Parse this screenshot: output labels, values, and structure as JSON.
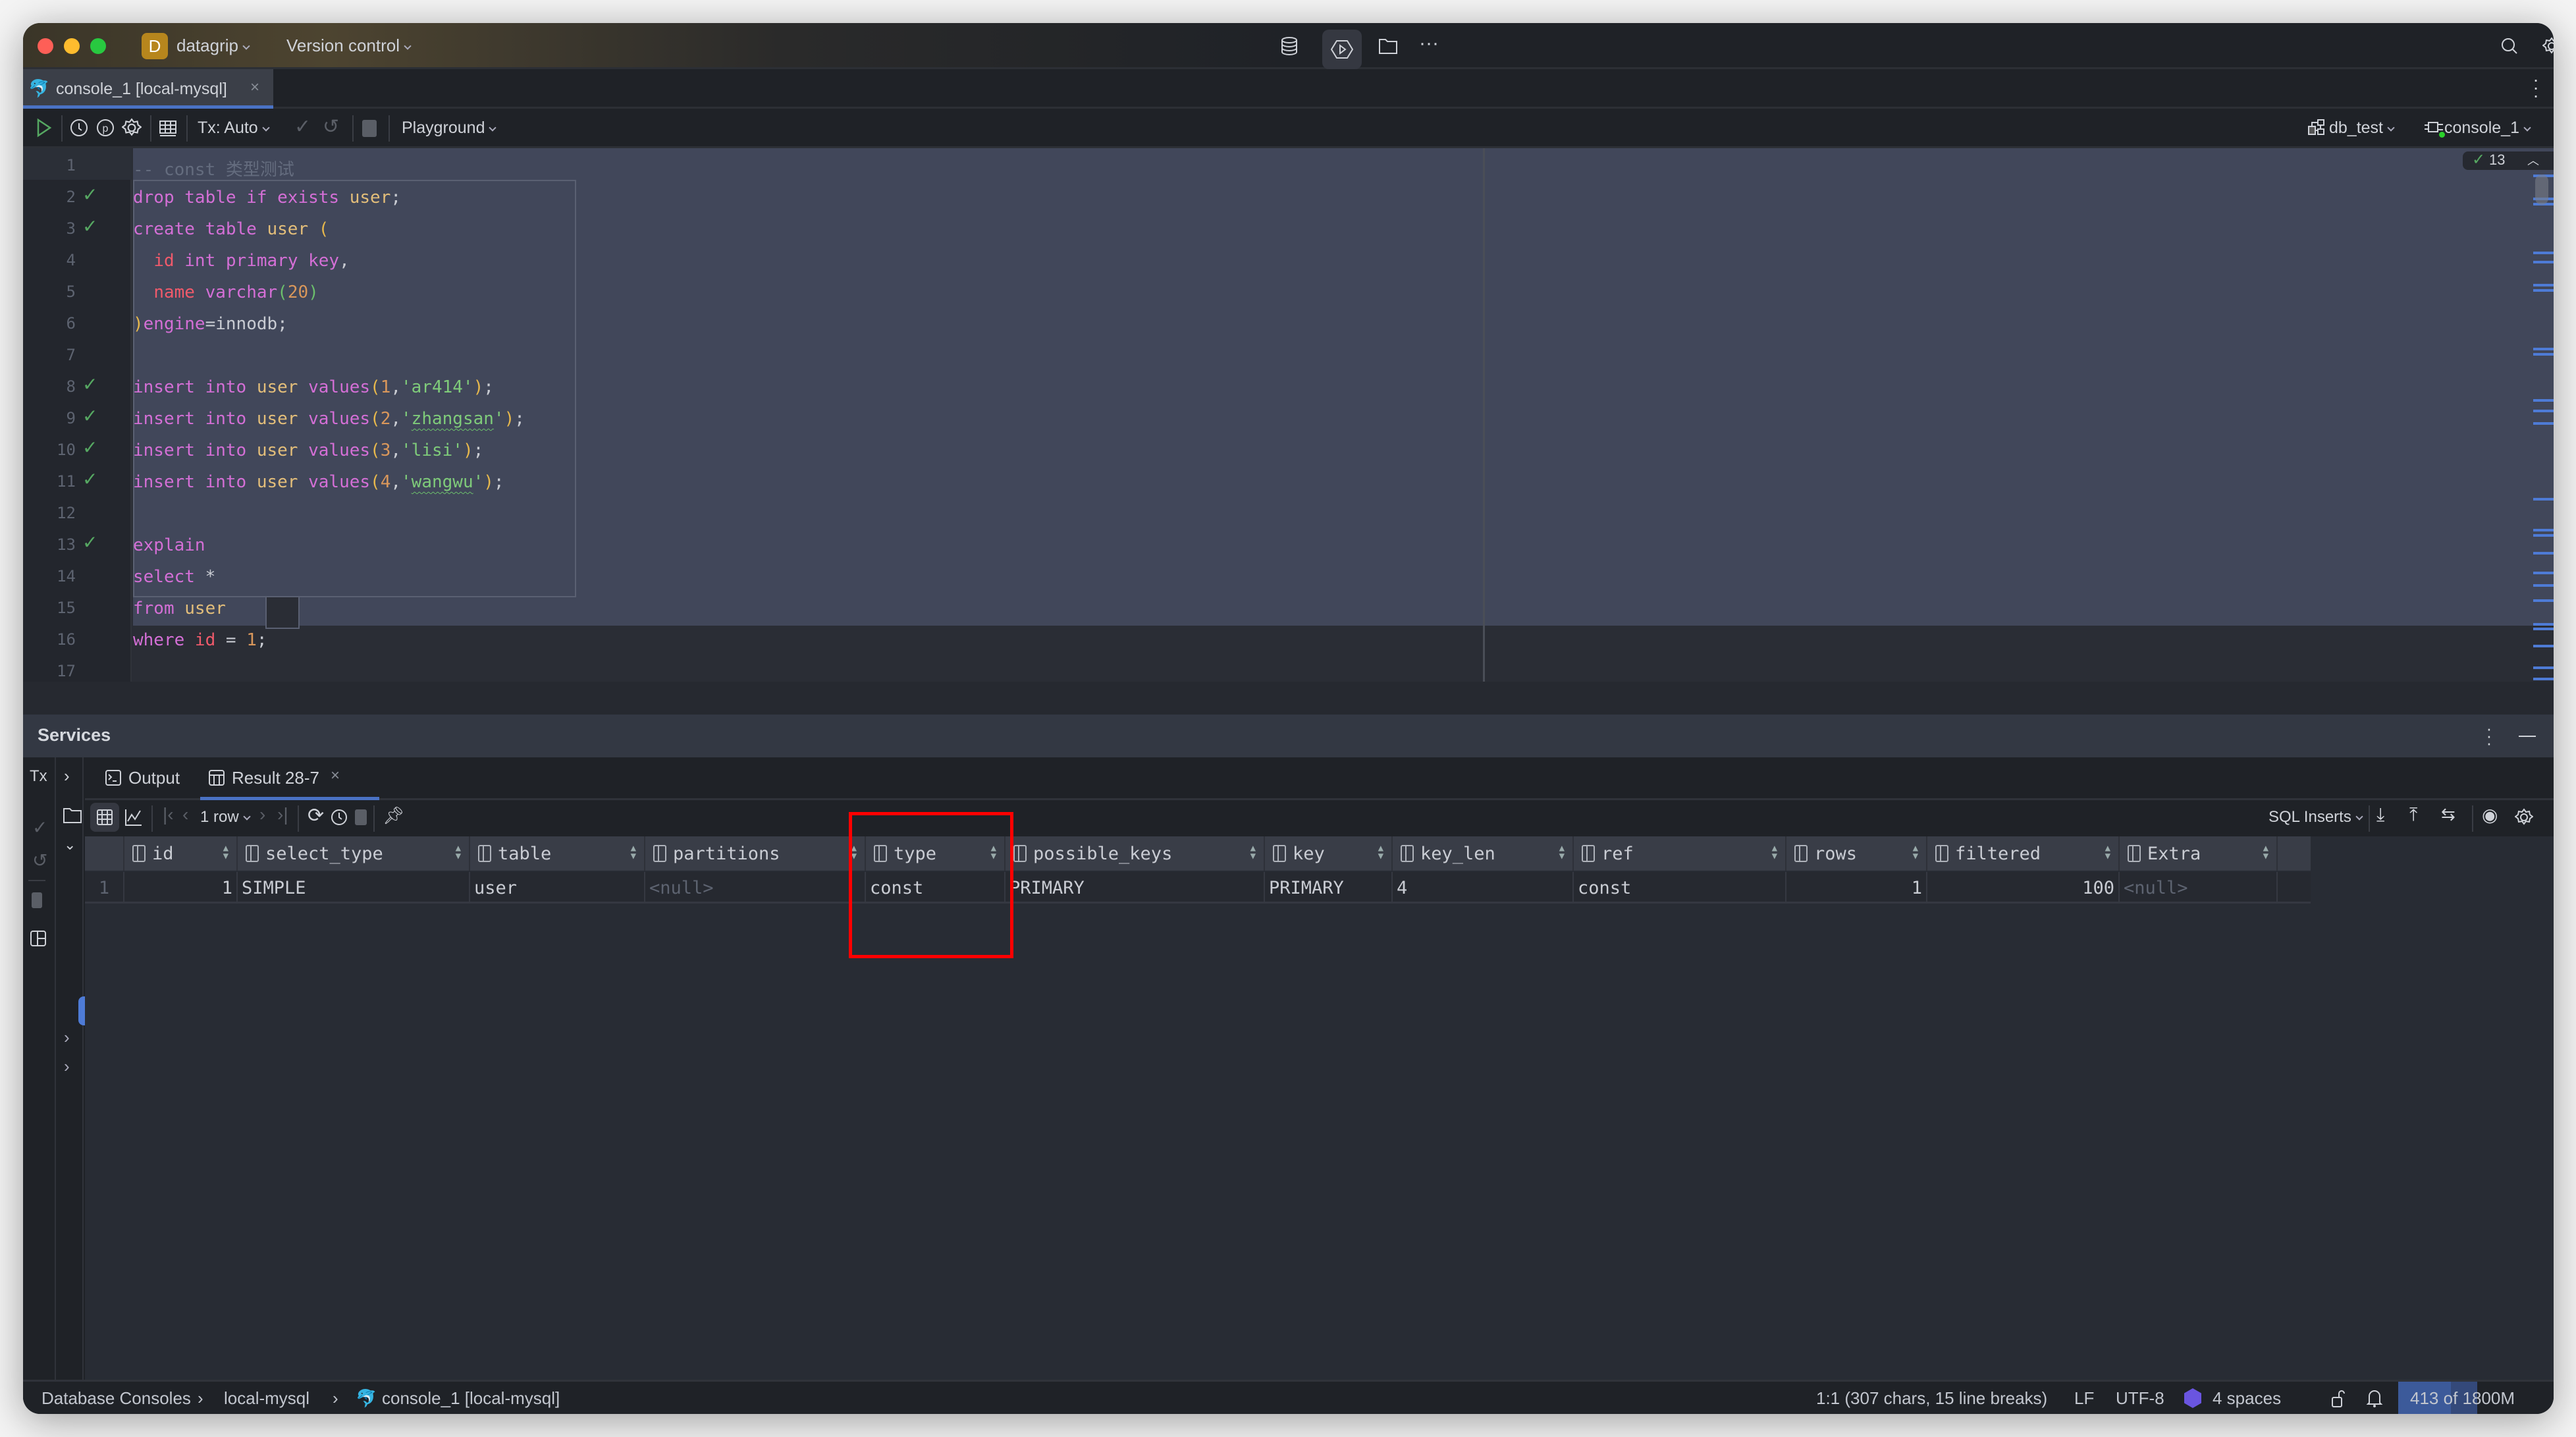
{
  "window": {
    "project_badge": "D",
    "project_name": "datagrip",
    "vcs_label": "Version control"
  },
  "editor_tab": {
    "label": "console_1 [local-mysql]",
    "close": "×"
  },
  "toolbar": {
    "tx_label": "Tx: Auto",
    "playground_label": "Playground",
    "schema_label": "db_test",
    "session_label": "console_1"
  },
  "inspection": {
    "count": "13"
  },
  "editor": {
    "lines": [
      {
        "n": "1",
        "check": false
      },
      {
        "n": "2",
        "check": true
      },
      {
        "n": "3",
        "check": true
      },
      {
        "n": "4",
        "check": false
      },
      {
        "n": "5",
        "check": false
      },
      {
        "n": "6",
        "check": false
      },
      {
        "n": "7",
        "check": false
      },
      {
        "n": "8",
        "check": true
      },
      {
        "n": "9",
        "check": true
      },
      {
        "n": "10",
        "check": true
      },
      {
        "n": "11",
        "check": true
      },
      {
        "n": "12",
        "check": false
      },
      {
        "n": "13",
        "check": true
      },
      {
        "n": "14",
        "check": false
      },
      {
        "n": "15",
        "check": false
      },
      {
        "n": "16",
        "check": false
      },
      {
        "n": "17",
        "check": false
      }
    ],
    "code": [
      [
        {
          "t": "-- const 类型测试",
          "c": "cmt"
        }
      ],
      [
        {
          "t": "drop table if exists ",
          "c": "kw"
        },
        {
          "t": "user",
          "c": "tb"
        },
        {
          "t": ";",
          "c": ""
        }
      ],
      [
        {
          "t": "create table ",
          "c": "kw"
        },
        {
          "t": "user ",
          "c": "tb"
        },
        {
          "t": "(",
          "c": "par"
        }
      ],
      [
        {
          "t": "  ",
          "c": ""
        },
        {
          "t": "id ",
          "c": "fld"
        },
        {
          "t": "int primary key",
          "c": "kw"
        },
        {
          "t": ",",
          "c": ""
        }
      ],
      [
        {
          "t": "  ",
          "c": ""
        },
        {
          "t": "name ",
          "c": "fld"
        },
        {
          "t": "varchar",
          "c": "kw"
        },
        {
          "t": "(",
          "c": "grn"
        },
        {
          "t": "20",
          "c": "num"
        },
        {
          "t": ")",
          "c": "grn"
        }
      ],
      [
        {
          "t": ")",
          "c": "par"
        },
        {
          "t": "engine",
          "c": "kw"
        },
        {
          "t": "=innodb;",
          "c": ""
        }
      ],
      [],
      [
        {
          "t": "insert into ",
          "c": "kw"
        },
        {
          "t": "user ",
          "c": "tb"
        },
        {
          "t": "values",
          "c": "kw"
        },
        {
          "t": "(",
          "c": "par"
        },
        {
          "t": "1",
          "c": "num"
        },
        {
          "t": ",",
          "c": ""
        },
        {
          "t": "'ar414'",
          "c": "str"
        },
        {
          "t": ")",
          "c": "par"
        },
        {
          "t": ";",
          "c": ""
        }
      ],
      [
        {
          "t": "insert into ",
          "c": "kw"
        },
        {
          "t": "user ",
          "c": "tb"
        },
        {
          "t": "values",
          "c": "kw"
        },
        {
          "t": "(",
          "c": "par"
        },
        {
          "t": "2",
          "c": "num"
        },
        {
          "t": ",",
          "c": ""
        },
        {
          "t": "'",
          "c": "str"
        },
        {
          "t": "zhangsan",
          "c": "str wavy"
        },
        {
          "t": "'",
          "c": "str"
        },
        {
          "t": ")",
          "c": "par"
        },
        {
          "t": ";",
          "c": ""
        }
      ],
      [
        {
          "t": "insert into ",
          "c": "kw"
        },
        {
          "t": "user ",
          "c": "tb"
        },
        {
          "t": "values",
          "c": "kw"
        },
        {
          "t": "(",
          "c": "par"
        },
        {
          "t": "3",
          "c": "num"
        },
        {
          "t": ",",
          "c": ""
        },
        {
          "t": "'lisi'",
          "c": "str"
        },
        {
          "t": ")",
          "c": "par"
        },
        {
          "t": ";",
          "c": ""
        }
      ],
      [
        {
          "t": "insert into ",
          "c": "kw"
        },
        {
          "t": "user ",
          "c": "tb"
        },
        {
          "t": "values",
          "c": "kw"
        },
        {
          "t": "(",
          "c": "par"
        },
        {
          "t": "4",
          "c": "num"
        },
        {
          "t": ",",
          "c": ""
        },
        {
          "t": "'",
          "c": "str"
        },
        {
          "t": "wangwu",
          "c": "str wavy"
        },
        {
          "t": "'",
          "c": "str"
        },
        {
          "t": ")",
          "c": "par"
        },
        {
          "t": ";",
          "c": ""
        }
      ],
      [],
      [
        {
          "t": "explain",
          "c": "kw"
        }
      ],
      [
        {
          "t": "select ",
          "c": "kw"
        },
        {
          "t": "*",
          "c": ""
        }
      ],
      [
        {
          "t": "from ",
          "c": "kw"
        },
        {
          "t": "user",
          "c": "tb"
        }
      ],
      [
        {
          "t": "where ",
          "c": "kw"
        },
        {
          "t": "id ",
          "c": "fld"
        },
        {
          "t": "= ",
          "c": ""
        },
        {
          "t": "1",
          "c": "num"
        },
        {
          "t": ";",
          "c": ""
        }
      ],
      []
    ]
  },
  "services": {
    "title": "Services",
    "tabs": [
      {
        "label": "Output"
      },
      {
        "label": "Result 28-7"
      }
    ],
    "rows_label": "1 row",
    "export_format": "SQL Inserts"
  },
  "result": {
    "columns": [
      "id",
      "select_type",
      "table",
      "partitions",
      "type",
      "possible_keys",
      "key",
      "key_len",
      "ref",
      "rows",
      "filtered",
      "Extra"
    ],
    "rows": [
      {
        "row_num": "1",
        "cells": [
          "1",
          "SIMPLE",
          "user",
          "<null>",
          "const",
          "PRIMARY",
          "PRIMARY",
          "4",
          "const",
          "1",
          "100",
          "<null>"
        ]
      }
    ]
  },
  "statusbar": {
    "breadcrumb": [
      "Database Consoles",
      "local-mysql",
      "console_1 [local-mysql]"
    ],
    "position": "1:1 (307 chars, 15 line breaks)",
    "line_sep": "LF",
    "encoding": "UTF-8",
    "indent": "4 spaces",
    "memory": "413 of 1800M"
  },
  "colors": {
    "accent": "#4a72c4",
    "highlight_box": "#ff0000",
    "success": "#56a862"
  }
}
